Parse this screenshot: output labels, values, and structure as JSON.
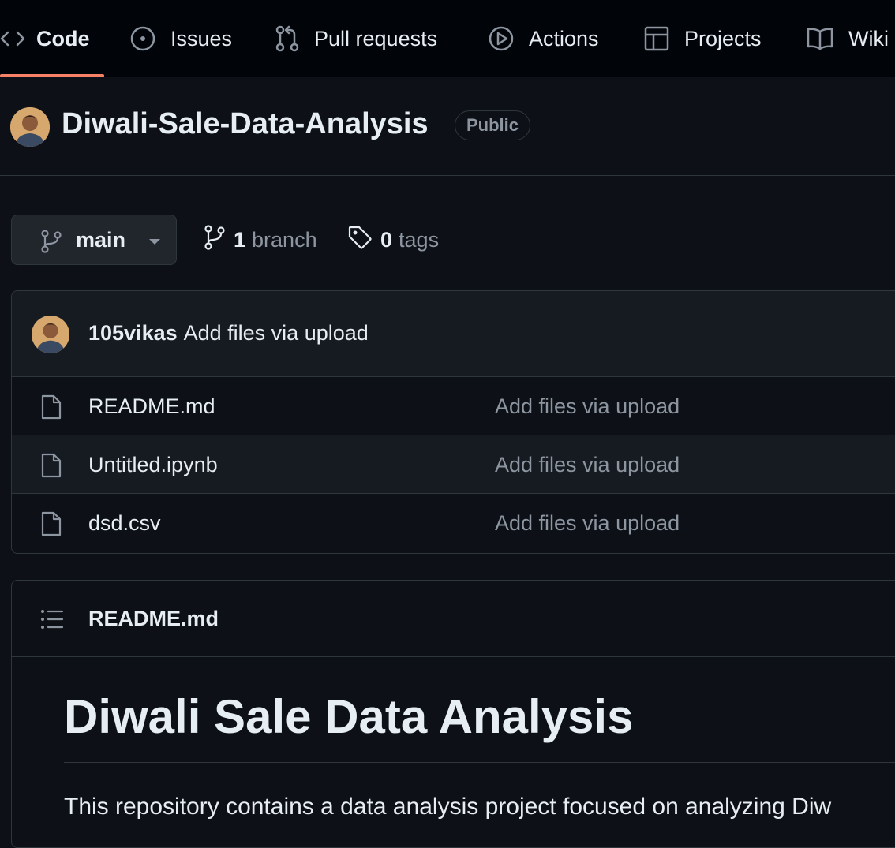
{
  "tabs": [
    {
      "label": "Code",
      "icon": "code-icon",
      "active": true
    },
    {
      "label": "Issues",
      "icon": "issue-opened-icon"
    },
    {
      "label": "Pull requests",
      "icon": "git-pull-request-icon"
    },
    {
      "label": "Actions",
      "icon": "play-icon"
    },
    {
      "label": "Projects",
      "icon": "table-icon"
    },
    {
      "label": "Wiki",
      "icon": "book-icon"
    }
  ],
  "repo": {
    "name": "Diwali-Sale-Data-Analysis",
    "visibility": "Public"
  },
  "branch": {
    "current": "main",
    "branch_count": "1",
    "branch_word": "branch",
    "tag_count": "0",
    "tag_word": "tags"
  },
  "latest_commit": {
    "author": "105vikas",
    "message": "Add files via upload"
  },
  "files": [
    {
      "name": "README.md",
      "commit": "Add files via upload",
      "icon": "file-icon"
    },
    {
      "name": "Untitled.ipynb",
      "commit": "Add files via upload",
      "icon": "file-icon"
    },
    {
      "name": "dsd.csv",
      "commit": "Add files via upload",
      "icon": "file-icon"
    }
  ],
  "readme": {
    "filename": "README.md",
    "heading": "Diwali Sale Data Analysis",
    "intro": "This repository contains a data analysis project focused on analyzing Diw"
  },
  "colors": {
    "accent": "#f78166",
    "background": "#0d1117",
    "muted_text": "#8d96a0",
    "border": "#30363d"
  }
}
